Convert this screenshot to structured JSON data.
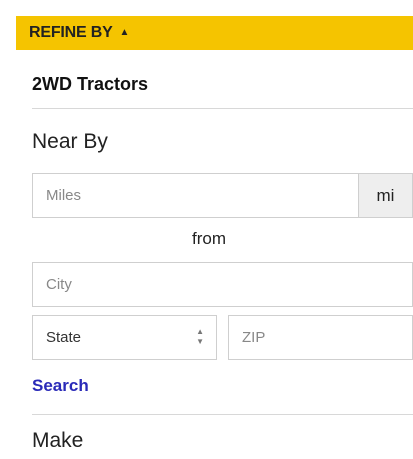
{
  "header": {
    "label": "REFINE BY",
    "caret": "▲"
  },
  "category": {
    "title": "2WD Tractors"
  },
  "near_by": {
    "title": "Near By",
    "miles_placeholder": "Miles",
    "unit": "mi",
    "from_label": "from",
    "city_placeholder": "City",
    "state_value": "State",
    "zip_placeholder": "ZIP",
    "search_label": "Search"
  },
  "make": {
    "title": "Make"
  }
}
